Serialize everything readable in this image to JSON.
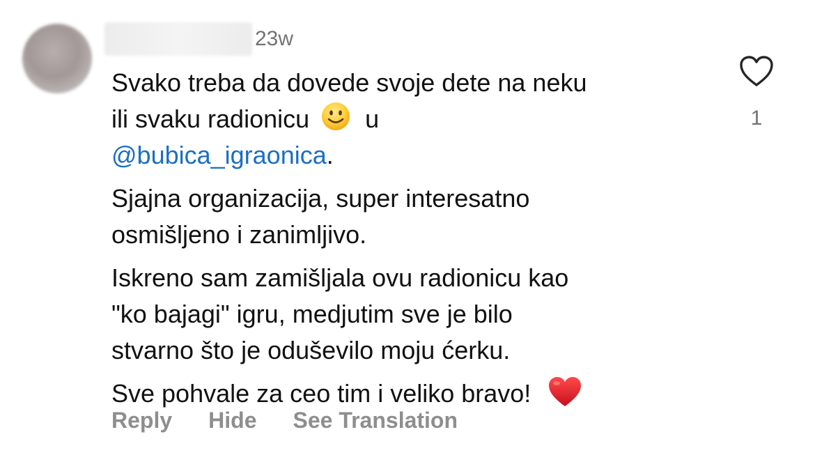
{
  "comment": {
    "timestamp": "23w",
    "paragraphs": [
      {
        "line1": "Svako treba da dovede svoje dete na neku",
        "line2_before_emoji": "ili svaku radionicu",
        "line2_after_emoji": "u",
        "mention": "@bubica_igraonica",
        "mention_suffix": "."
      },
      {
        "lines": [
          "Sjajna organizacija, super interesatno",
          "osmišljeno i zanimljivo."
        ]
      },
      {
        "lines": [
          "Iskreno sam zamišljala ovu radionicu kao",
          "\"ko bajagi\" igru, medjutim sve je bilo",
          "stvarno što je oduševilo moju ćerku."
        ]
      },
      {
        "text": "Sve pohvale za ceo tim i veliko bravo!"
      }
    ],
    "emojis": [
      "smiling-face-emoji",
      "red-heart-emoji"
    ]
  },
  "actions": {
    "reply": "Reply",
    "hide": "Hide",
    "see_translation": "See Translation"
  },
  "like": {
    "icon": "heart-outline-icon",
    "count": "1"
  },
  "colors": {
    "mention": "#1a6fc4",
    "secondary_text": "#737373",
    "action_text": "#8e8e8e"
  }
}
